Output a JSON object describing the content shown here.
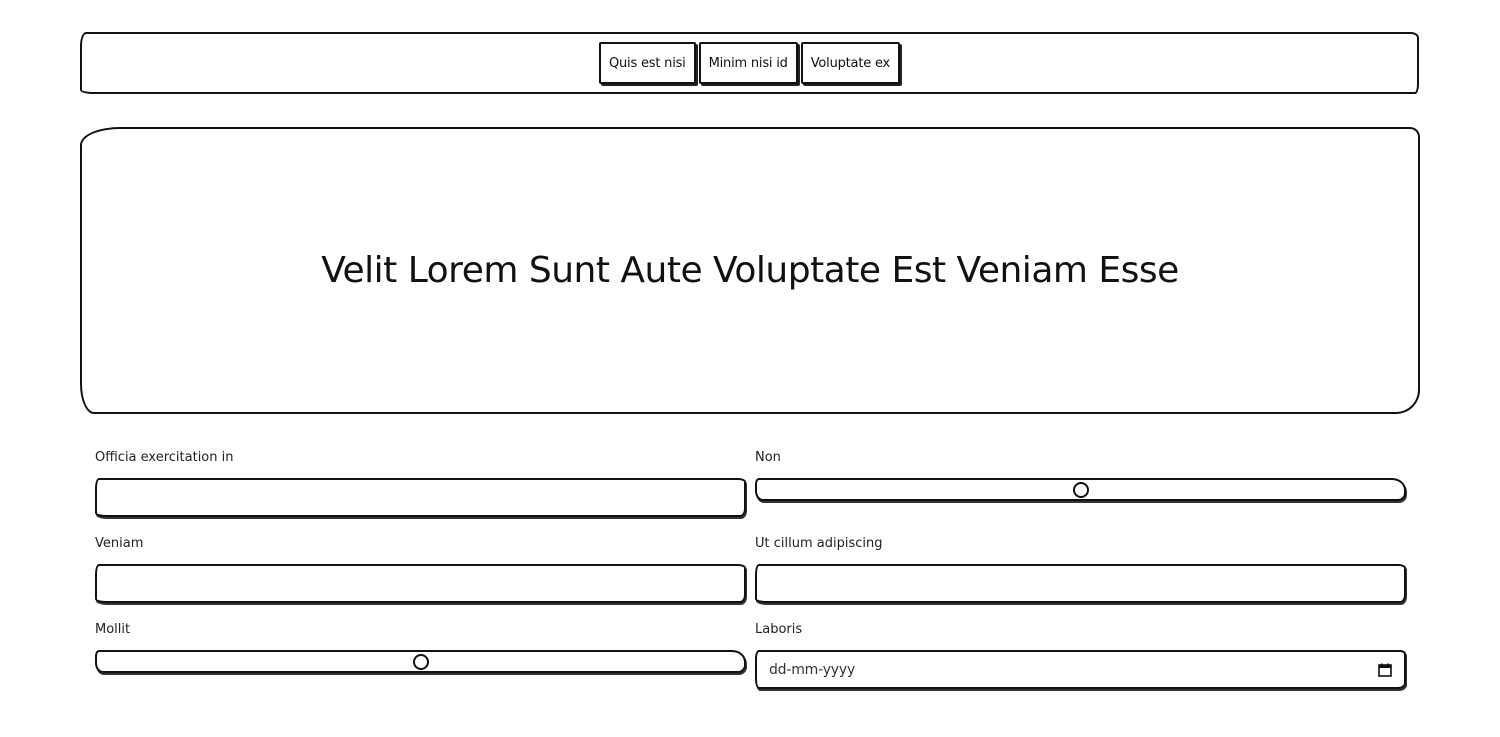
{
  "nav": {
    "items": [
      {
        "label": "Quis est nisi"
      },
      {
        "label": "Minim nisi id"
      },
      {
        "label": "Voluptate ex"
      }
    ]
  },
  "hero": {
    "title": "Velit Lorem Sunt Aute Voluptate Est Veniam Esse"
  },
  "form": {
    "fields": [
      {
        "label": "Officia exercitation in",
        "type": "text",
        "value": ""
      },
      {
        "label": "Non",
        "type": "range",
        "value_fraction": 0.5
      },
      {
        "label": "Veniam",
        "type": "text",
        "value": ""
      },
      {
        "label": "Ut cillum adipiscing",
        "type": "text",
        "value": ""
      },
      {
        "label": "Mollit",
        "type": "range",
        "value_fraction": 0.5
      },
      {
        "label": "Laboris",
        "type": "date",
        "placeholder": "dd-mm-yyyy",
        "icon": "calendar-icon"
      }
    ]
  }
}
